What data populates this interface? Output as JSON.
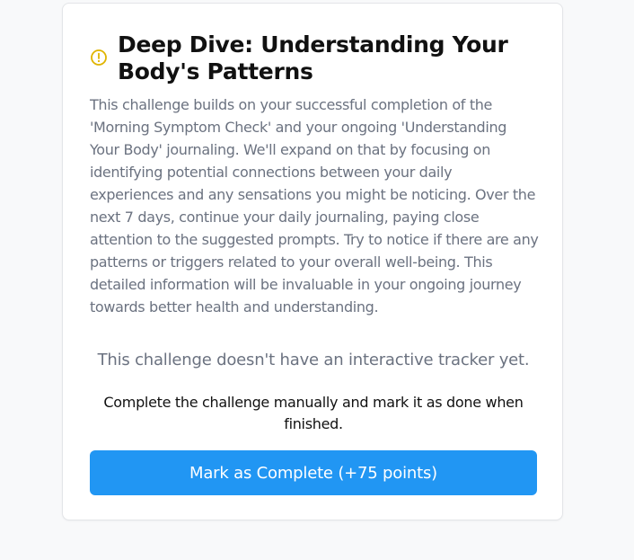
{
  "challenge": {
    "icon": "alert-circle-icon",
    "title": "Deep Dive: Understanding Your Body's Patterns",
    "description": "This challenge builds on your successful completion of the 'Morning Symptom Check' and your ongoing 'Understanding Your Body' journaling. We'll expand on that by focusing on identifying potential connections between your daily experiences and any sensations you might be noticing. Over the next 7 days, continue your daily journaling, paying close attention to the suggested prompts. Try to notice if there are any patterns or triggers related to your overall well-being. This detailed information will be invaluable in your ongoing journey towards better health and understanding.",
    "no_tracker_message": "This challenge doesn't have an interactive tracker yet.",
    "manual_instruction": "Complete the challenge manually and mark it as done when finished.",
    "complete_button_label": "Mark as Complete (+75 points)"
  },
  "colors": {
    "icon": "#e0b400",
    "button": "#2196f3",
    "text_muted": "#6b7280",
    "text_dark": "#111111"
  }
}
